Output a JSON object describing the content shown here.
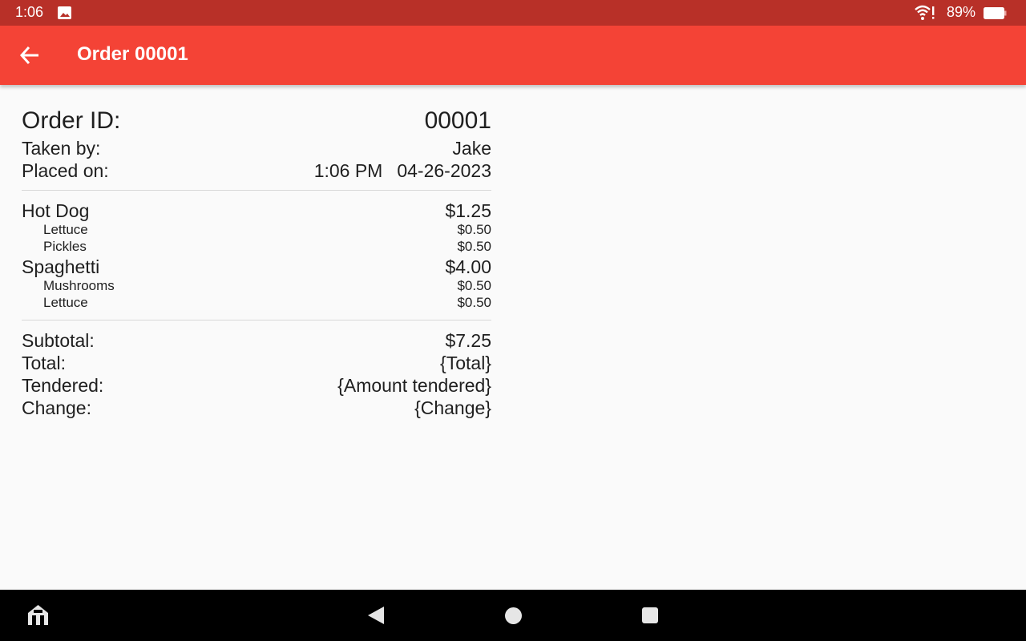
{
  "status_bar": {
    "time": "1:06",
    "battery_percent": "89%"
  },
  "app_bar": {
    "title": "Order 00001",
    "back_icon": "arrow-left-icon"
  },
  "order": {
    "id_label": "Order ID:",
    "id_value": "00001",
    "taken_label": "Taken by:",
    "taken_value": "Jake",
    "placed_label": "Placed on:",
    "placed_time": "1:06 PM",
    "placed_date": "04-26-2023"
  },
  "items": [
    {
      "name": "Hot Dog",
      "price": "$1.25",
      "extras": [
        {
          "name": "Lettuce",
          "price": "$0.50"
        },
        {
          "name": "Pickles",
          "price": "$0.50"
        }
      ]
    },
    {
      "name": "Spaghetti",
      "price": "$4.00",
      "extras": [
        {
          "name": "Mushrooms",
          "price": "$0.50"
        },
        {
          "name": "Lettuce",
          "price": "$0.50"
        }
      ]
    }
  ],
  "totals": {
    "subtotal_label": "Subtotal:",
    "subtotal_value": "$7.25",
    "total_label": "Total:",
    "total_value": "{Total}",
    "tendered_label": "Tendered:",
    "tendered_value": "{Amount tendered}",
    "change_label": "Change:",
    "change_value": "{Change}"
  },
  "colors": {
    "status_bar": "#b83028",
    "app_bar": "#f44336",
    "background": "#fafafa",
    "nav_bar": "#000000"
  },
  "nav": {
    "icons": [
      "home-app-icon",
      "back-triangle-icon",
      "home-circle-icon",
      "recents-square-icon"
    ]
  }
}
